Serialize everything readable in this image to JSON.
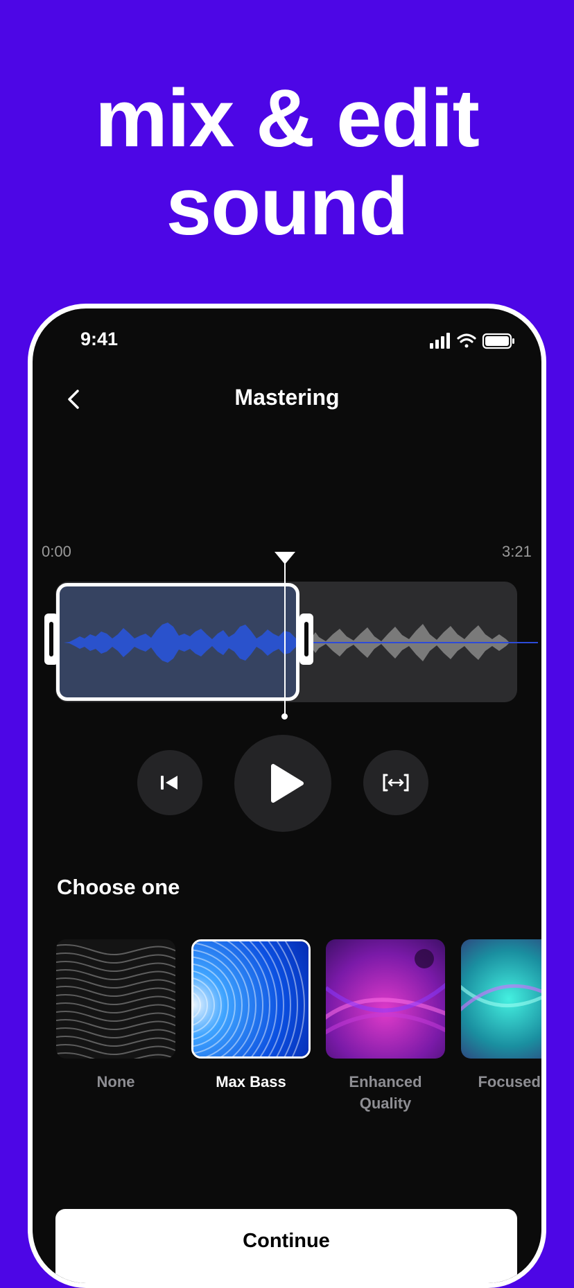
{
  "promo": {
    "headline_line1": "mix & edit",
    "headline_line2": "sound"
  },
  "status_bar": {
    "time": "9:41"
  },
  "nav": {
    "title": "Mastering"
  },
  "timeline": {
    "start_time": "0:00",
    "end_time": "3:21"
  },
  "section": {
    "title": "Choose one"
  },
  "options": [
    {
      "label": "None",
      "selected": false
    },
    {
      "label": "Max Bass",
      "selected": true
    },
    {
      "label": "Enhanced Quality",
      "selected": false
    },
    {
      "label": "Focused Vo",
      "selected": false
    }
  ],
  "footer": {
    "continue_label": "Continue"
  },
  "colors": {
    "background": "#4d06e6",
    "wave_active": "#1846e6",
    "wave_inactive": "#7a7a7a",
    "screen": "#0b0b0b"
  }
}
